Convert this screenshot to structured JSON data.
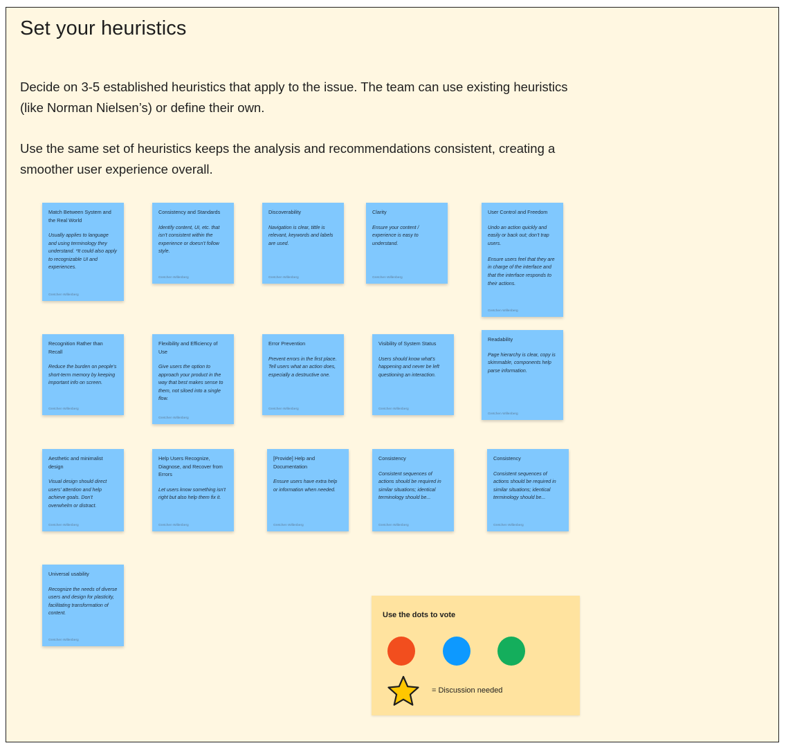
{
  "title": "Set your heuristics",
  "paragraphs": [
    "Decide on 3-5 established heuristics that apply to the issue. The team can use existing heuristics (like Norman Nielsen’s) or define their own.",
    "Use the same set of heuristics keeps the analysis and recommendations consistent, creating a smoother user experience overall."
  ],
  "sticky_color": "#80c8fe",
  "stickies": [
    {
      "title": "Match Between System and the Real World",
      "body": "Usually applies to language and using terminology they understand. *It could also apply to recognizable UI and experiences.",
      "author": "Gretchen Willenberg"
    },
    {
      "title": "Consistency and Standards",
      "body": "Identify content, UI, etc. that isn’t consistent within the experience or doesn’t follow style.",
      "author": "Gretchen Willenberg"
    },
    {
      "title": "Discoverability",
      "body": "Navigation is clear, tittle is relevant, keywords and labels are used.",
      "author": "Gretchen Willenberg"
    },
    {
      "title": "Clarity",
      "body": "Ensure your content / experience is easy to understand.",
      "author": "Gretchen Willenberg"
    },
    {
      "title": "User Control and Freedom",
      "body": "Undo an action quickly and easily or back out; don’t trap users.\n\nEnsure users feel that they are in charge of the interface and that the interface responds to their actions.",
      "author": "Gretchen Willenberg"
    },
    {
      "title": "Recognition Rather than Recall",
      "body": "Reduce the burden on people’s short-term memory by keeping important info on screen.",
      "author": "Gretchen Willenberg"
    },
    {
      "title": "Flexibility and Efficiency of Use",
      "body": "Give users the option to approach your product in the way that best makes sense to them, not siloed into a single flow.",
      "author": "Gretchen Willenberg"
    },
    {
      "title": "Error Prevention",
      "body": "Prevent errors in the first place. Tell users what an action does, especially a destructive one.",
      "author": "Gretchen Willenberg"
    },
    {
      "title": "Visibility of System Status",
      "body": "Users should know what’s happening and never be left questioning an interaction.",
      "author": "Gretchen Willenberg"
    },
    {
      "title": "Readability",
      "body": "Page hierarchy is clear, copy is skimmable, components help parse information.",
      "author": "Gretchen Willenberg"
    },
    {
      "title": "Aesthetic and minimalist design",
      "body": "Visual design should direct users’ attention and help achieve goals. Don’t overwhelm or distract.",
      "author": "Gretchen Willenberg"
    },
    {
      "title": "Help Users Recognize, Diagnose, and Recover from Errors",
      "body": "Let users know something isn’t right but also help them fix it.",
      "author": "Gretchen Willenberg"
    },
    {
      "title": "[Provide] Help and Documentation",
      "body": "Ensure users have extra help or information when needed.",
      "author": "Gretchen Willenberg"
    },
    {
      "title": "Consistency",
      "body": "Consistent sequences of actions should be required in similar situations; identical terminology should be...",
      "author": "Gretchen Willenberg"
    },
    {
      "title": "Consistency",
      "body": "Consistent sequences of actions should be required in similar situations; identical terminology should be...",
      "author": "Gretchen Willenberg"
    },
    {
      "title": "Universal usability",
      "body": "Recognize the needs of diverse users and design for plasticity, facilitating transformation of content.",
      "author": "Gretchen Willenberg"
    }
  ],
  "vote": {
    "title": "Use the dots to vote",
    "dots": [
      {
        "name": "red",
        "color": "#f24e1e"
      },
      {
        "name": "blue",
        "color": "#0d99ff"
      },
      {
        "name": "green",
        "color": "#14ae5c"
      }
    ],
    "star_icon": "star-icon",
    "star_color": "#ffc700",
    "legend": "= Discussion needed"
  }
}
